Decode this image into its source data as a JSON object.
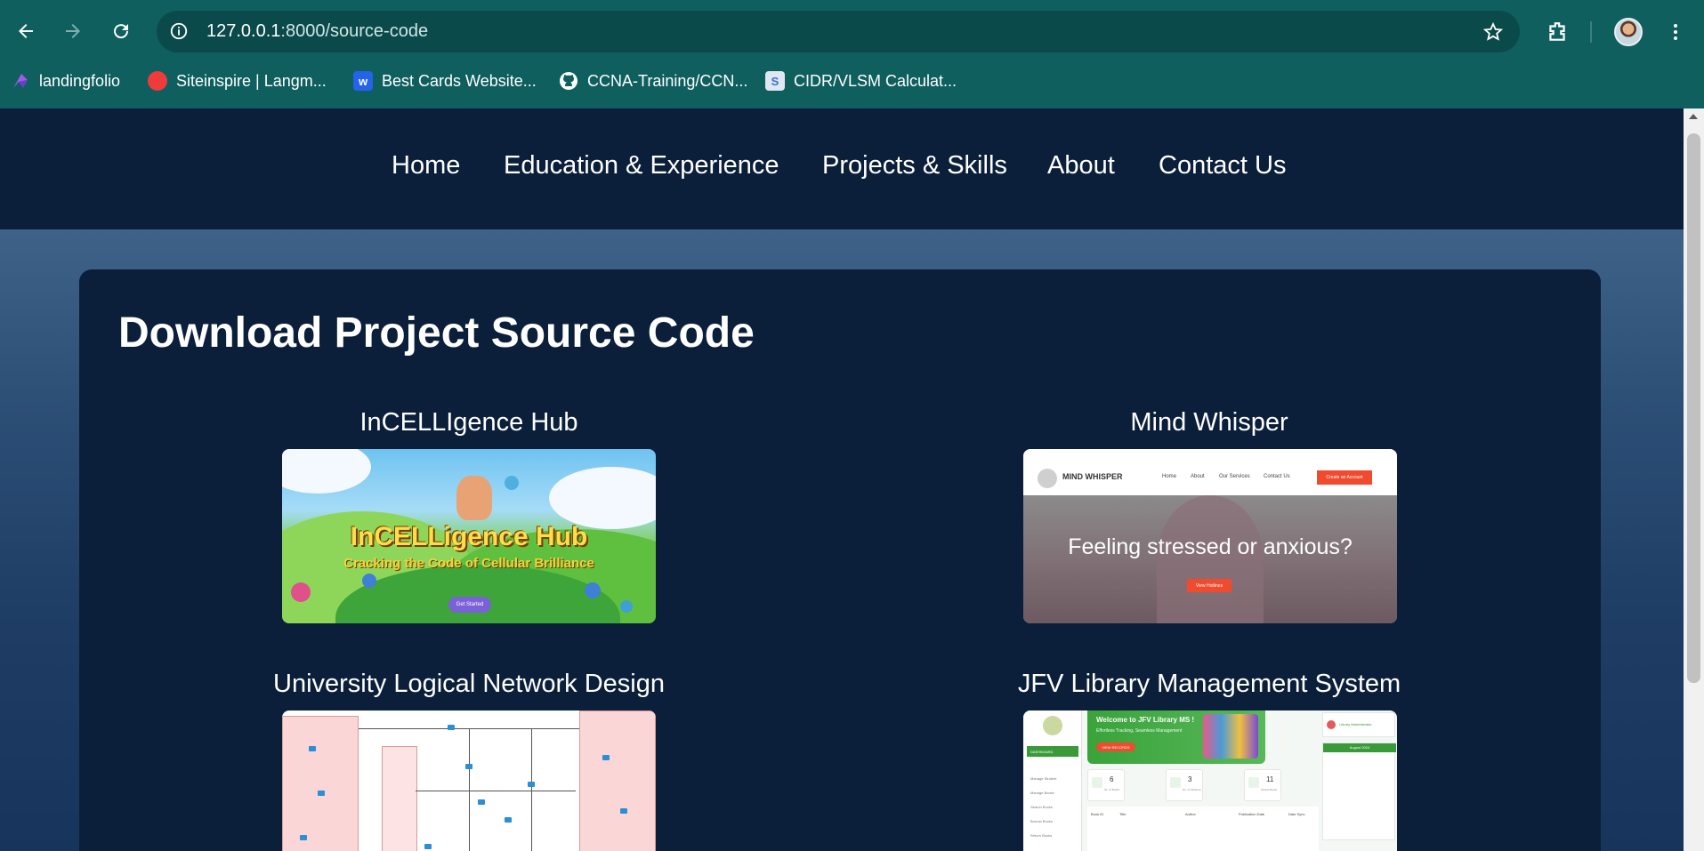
{
  "browser": {
    "url_host": "127.0.0.1",
    "url_rest": ":8000/source-code",
    "bookmarks": [
      {
        "label": "landingfolio",
        "icon": "landingfolio-icon",
        "color": "#8a4fd6"
      },
      {
        "label": "Siteinspire | Langm...",
        "icon": "siteinspire-icon",
        "color": "#ef3b3b"
      },
      {
        "label": "Best Cards Website...",
        "icon": "webflow-icon",
        "color": "#2563eb"
      },
      {
        "label": "CCNA-Training/CCN...",
        "icon": "github-icon",
        "color": "#ffffff"
      },
      {
        "label": "CIDR/VLSM Calculat...",
        "icon": "subnet-calculator-icon",
        "color": "#3b6fd6"
      }
    ]
  },
  "site": {
    "nav": [
      "Home",
      "Education & Experience",
      "Projects & Skills",
      "About",
      "Contact Us"
    ],
    "page_title": "Download Project Source Code",
    "projects": [
      {
        "title": "InCELLIgence Hub",
        "thumb_title": "InCELLigence Hub",
        "thumb_subtitle": "Cracking the Code of Cellular Brilliance",
        "thumb_cta": "Get Started"
      },
      {
        "title": "Mind Whisper",
        "thumb_headline": "Feeling stressed or anxious?",
        "thumb_logo": "MIND WHISPER",
        "thumb_cta": "Create an Account",
        "thumb_btn": "View Hotlines"
      },
      {
        "title": "University Logical Network Design"
      },
      {
        "title": "JFV Library Management System",
        "thumb_welcome": "Welcome to JFV Library MS !",
        "thumb_sub": "Effortless Tracking, Seamless Management",
        "thumb_btn": "VIEW RECORDS",
        "thumb_active": "DASHBOARD",
        "thumb_profile": "Library Administrator",
        "thumb_stats": [
          {
            "n": "6",
            "l": "No. of Books"
          },
          {
            "n": "3",
            "l": "No. of Students"
          },
          {
            "n": "11",
            "l": "Issued Books"
          }
        ],
        "thumb_calendar": "August 2024"
      }
    ]
  },
  "colors": {
    "chrome": "#0f5f5f",
    "nav_bg": "#0b1f3a",
    "accent": "#f04a2f"
  }
}
